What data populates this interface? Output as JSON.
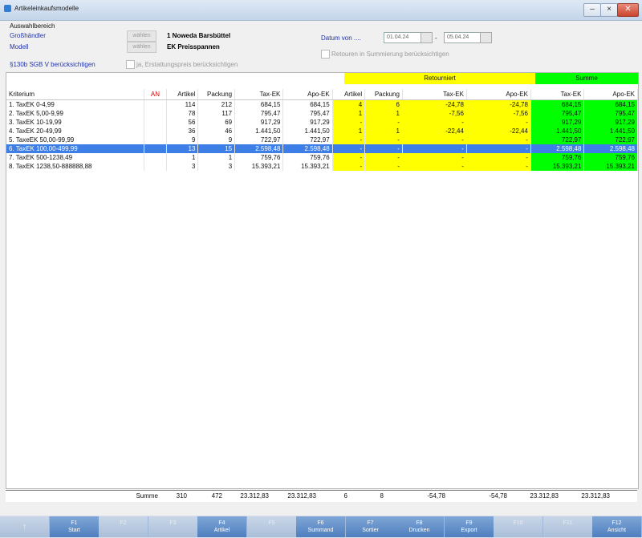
{
  "window": {
    "title": "Artikeleinkaufsmodelle"
  },
  "filter": {
    "section_label": "Auswahlbereich",
    "grosshaendler_label": "Großhändler",
    "modell_label": "Modell",
    "choose_label": "wählen",
    "grosshaendler_value": "1 Noweda Barsbüttel",
    "modell_value": "EK Preisspannen",
    "sgb_label": "§130b SGB V berücksichtigen",
    "sgb_checkbox_label": "ja, Erstattungspreis berücksichtigen",
    "datum_label": "Datum von ....",
    "date_from": "01.04.24",
    "date_to": "05.04.24",
    "retouren_label": "Retouren in Summierung berücksichtigen"
  },
  "grid": {
    "group_retour": "Retourniert",
    "group_summe": "Summe",
    "columns": [
      "Kriterium",
      "AN",
      "Artikel",
      "Packung",
      "Tax-EK",
      "Apo-EK",
      "Artikel",
      "Packung",
      "Tax-EK",
      "Apo-EK",
      "Tax-EK",
      "Apo-EK"
    ],
    "rows": [
      [
        "1. TaxEK 0-4,99",
        "",
        "114",
        "212",
        "684,15",
        "684,15",
        "4",
        "6",
        "-24,78",
        "-24,78",
        "684,15",
        "684,15"
      ],
      [
        "2. TaxEK 5,00-9,99",
        "",
        "78",
        "117",
        "795,47",
        "795,47",
        "1",
        "1",
        "-7,56",
        "-7,56",
        "795,47",
        "795,47"
      ],
      [
        "3. TaxEK 10-19,99",
        "",
        "56",
        "69",
        "917,29",
        "917,29",
        "-",
        "-",
        "-",
        "-",
        "917,29",
        "917,29"
      ],
      [
        "4. TaxEK 20-49,99",
        "",
        "36",
        "46",
        "1.441,50",
        "1.441,50",
        "1",
        "1",
        "-22,44",
        "-22,44",
        "1.441,50",
        "1.441,50"
      ],
      [
        "5. TaxeEK 50,00-99,99",
        "",
        "9",
        "9",
        "722,97",
        "722,97",
        "-",
        "-",
        "-",
        "-",
        "722,97",
        "722,97"
      ],
      [
        "6. TaxEK 100,00-499,99",
        "",
        "13",
        "15",
        "2.598,48",
        "2.598,48",
        "-",
        "-",
        "-",
        "-",
        "2.598,48",
        "2.598,48"
      ],
      [
        "7. TaxEK 500-1238,49",
        "",
        "1",
        "1",
        "759,76",
        "759,76",
        "-",
        "-",
        "-",
        "-",
        "759,76",
        "759,76"
      ],
      [
        "8. TaxEK 1238,50-888888,88",
        "",
        "3",
        "3",
        "15.393,21",
        "15.393,21",
        "-",
        "-",
        "-",
        "-",
        "15.393,21",
        "15.393,21"
      ]
    ],
    "selected_row": 5,
    "summe_label": "Summe",
    "summe": [
      "310",
      "472",
      "23.312,83",
      "23.312,83",
      "6",
      "8",
      "-54,78",
      "-54,78",
      "23.312,83",
      "23.312,83"
    ]
  },
  "fkeys": [
    {
      "num": "↑",
      "label": ""
    },
    {
      "num": "F1",
      "label": "Start"
    },
    {
      "num": "F2",
      "label": ""
    },
    {
      "num": "F3",
      "label": ""
    },
    {
      "num": "F4",
      "label": "Artikel"
    },
    {
      "num": "F5",
      "label": ""
    },
    {
      "num": "F6",
      "label": "Summand"
    },
    {
      "num": "F7",
      "label": "Sortier"
    },
    {
      "num": "F8",
      "label": "Drucken"
    },
    {
      "num": "F9",
      "label": "Export"
    },
    {
      "num": "F10",
      "label": ""
    },
    {
      "num": "F11",
      "label": ""
    },
    {
      "num": "F12",
      "label": "Ansicht"
    }
  ],
  "colors": {
    "yellow": "#ffff00",
    "green": "#00ff00",
    "selection": "#3d7fe6",
    "fkey": "#4f7fbf"
  }
}
